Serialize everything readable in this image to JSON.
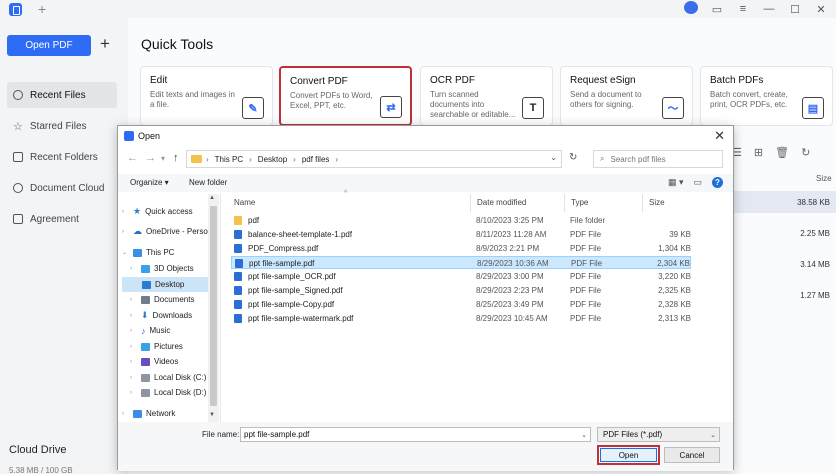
{
  "app": {
    "open_pdf": "Open PDF",
    "add": "+",
    "tab_add": "+",
    "nav": [
      {
        "label": "Recent Files"
      },
      {
        "label": "Starred Files"
      },
      {
        "label": "Recent Folders"
      },
      {
        "label": "Document Cloud"
      },
      {
        "label": "Agreement"
      }
    ],
    "cloud_title": "Cloud Drive",
    "cloud_size": "5.38 MB / 100 GB",
    "quick_tools_title": "Quick Tools",
    "cards": [
      {
        "title": "Edit",
        "desc": "Edit texts and images in a file.",
        "icon": "edit-icon"
      },
      {
        "title": "Convert PDF",
        "desc": "Convert PDFs to Word, Excel, PPT, etc.",
        "icon": "convert-icon"
      },
      {
        "title": "OCR PDF",
        "desc": "Turn scanned documents into searchable or editable...",
        "icon": "ocr-icon",
        "glyph": "T"
      },
      {
        "title": "Request eSign",
        "desc": "Send a document to others for signing.",
        "icon": "esign-icon"
      },
      {
        "title": "Batch PDFs",
        "desc": "Batch convert, create, print, OCR PDFs, etc.",
        "icon": "batch-icon"
      }
    ],
    "bg_size_header": "Size",
    "bg_sizes": [
      "38.58 KB",
      "2.25 MB",
      "3.14 MB",
      "1.27 MB"
    ]
  },
  "dialog": {
    "title": "Open",
    "close": "✕",
    "breadcrumb": [
      "This PC",
      "Desktop",
      "pdf files"
    ],
    "search_placeholder": "Search pdf files",
    "organize": "Organize ▾",
    "new_folder": "New folder",
    "help": "?",
    "tree": [
      {
        "label": "Quick access",
        "icon": "star-icon",
        "color": "#2b7cd3"
      },
      {
        "label": "OneDrive - Person",
        "icon": "cloud-icon",
        "color": "#1e6fd8"
      },
      {
        "label": "This PC",
        "icon": "computer-icon",
        "color": "#3a8ee6"
      },
      {
        "label": "3D Objects",
        "icon": "cube-icon",
        "color": "#3aa0e8"
      },
      {
        "label": "Desktop",
        "icon": "desktop-icon",
        "color": "#2b7cd3"
      },
      {
        "label": "Documents",
        "icon": "documents-icon",
        "color": "#6f7c8c"
      },
      {
        "label": "Downloads",
        "icon": "download-icon",
        "color": "#2b7cd3"
      },
      {
        "label": "Music",
        "icon": "music-icon",
        "color": "#1e6fd8"
      },
      {
        "label": "Pictures",
        "icon": "pictures-icon",
        "color": "#3aa0e8"
      },
      {
        "label": "Videos",
        "icon": "video-icon",
        "color": "#6a4cc2"
      },
      {
        "label": "Local Disk (C:)",
        "icon": "disk-icon",
        "color": "#8c96a3"
      },
      {
        "label": "Local Disk (D:)",
        "icon": "disk-icon",
        "color": "#8c96a3"
      },
      {
        "label": "Network",
        "icon": "network-icon",
        "color": "#3a8ee6"
      }
    ],
    "columns": {
      "name": "Name",
      "date": "Date modified",
      "type": "Type",
      "size": "Size"
    },
    "files": [
      {
        "name": "pdf",
        "date": "8/10/2023 3:25 PM",
        "type": "File folder",
        "size": "",
        "kind": "folder"
      },
      {
        "name": "balance-sheet-template-1.pdf",
        "date": "8/11/2023 11:28 AM",
        "type": "PDF File",
        "size": "39 KB",
        "kind": "pdf"
      },
      {
        "name": "PDF_Compress.pdf",
        "date": "8/9/2023 2:21 PM",
        "type": "PDF File",
        "size": "1,304 KB",
        "kind": "pdf"
      },
      {
        "name": "ppt file-sample.pdf",
        "date": "8/29/2023 10:36 AM",
        "type": "PDF File",
        "size": "2,304 KB",
        "kind": "pdf"
      },
      {
        "name": "ppt file-sample_OCR.pdf",
        "date": "8/29/2023 3:00 PM",
        "type": "PDF File",
        "size": "3,220 KB",
        "kind": "pdf"
      },
      {
        "name": "ppt file-sample_Signed.pdf",
        "date": "8/29/2023 2:23 PM",
        "type": "PDF File",
        "size": "2,325 KB",
        "kind": "pdf"
      },
      {
        "name": "ppt file-sample-Copy.pdf",
        "date": "8/25/2023 3:49 PM",
        "type": "PDF File",
        "size": "2,328 KB",
        "kind": "pdf"
      },
      {
        "name": "ppt file-sample-watermark.pdf",
        "date": "8/29/2023 10:45 AM",
        "type": "PDF File",
        "size": "2,313 KB",
        "kind": "pdf"
      }
    ],
    "selected_file_index": 3,
    "file_name_label": "File name:",
    "file_name_value": "ppt file-sample.pdf",
    "file_type": "PDF Files (*.pdf)",
    "open_btn": "Open",
    "cancel_btn": "Cancel"
  },
  "colors": {
    "accent": "#2f6cf6",
    "highlight": "#c0303a",
    "folder": "#f2c24b",
    "pdf_icon": "#2b6fd4"
  }
}
